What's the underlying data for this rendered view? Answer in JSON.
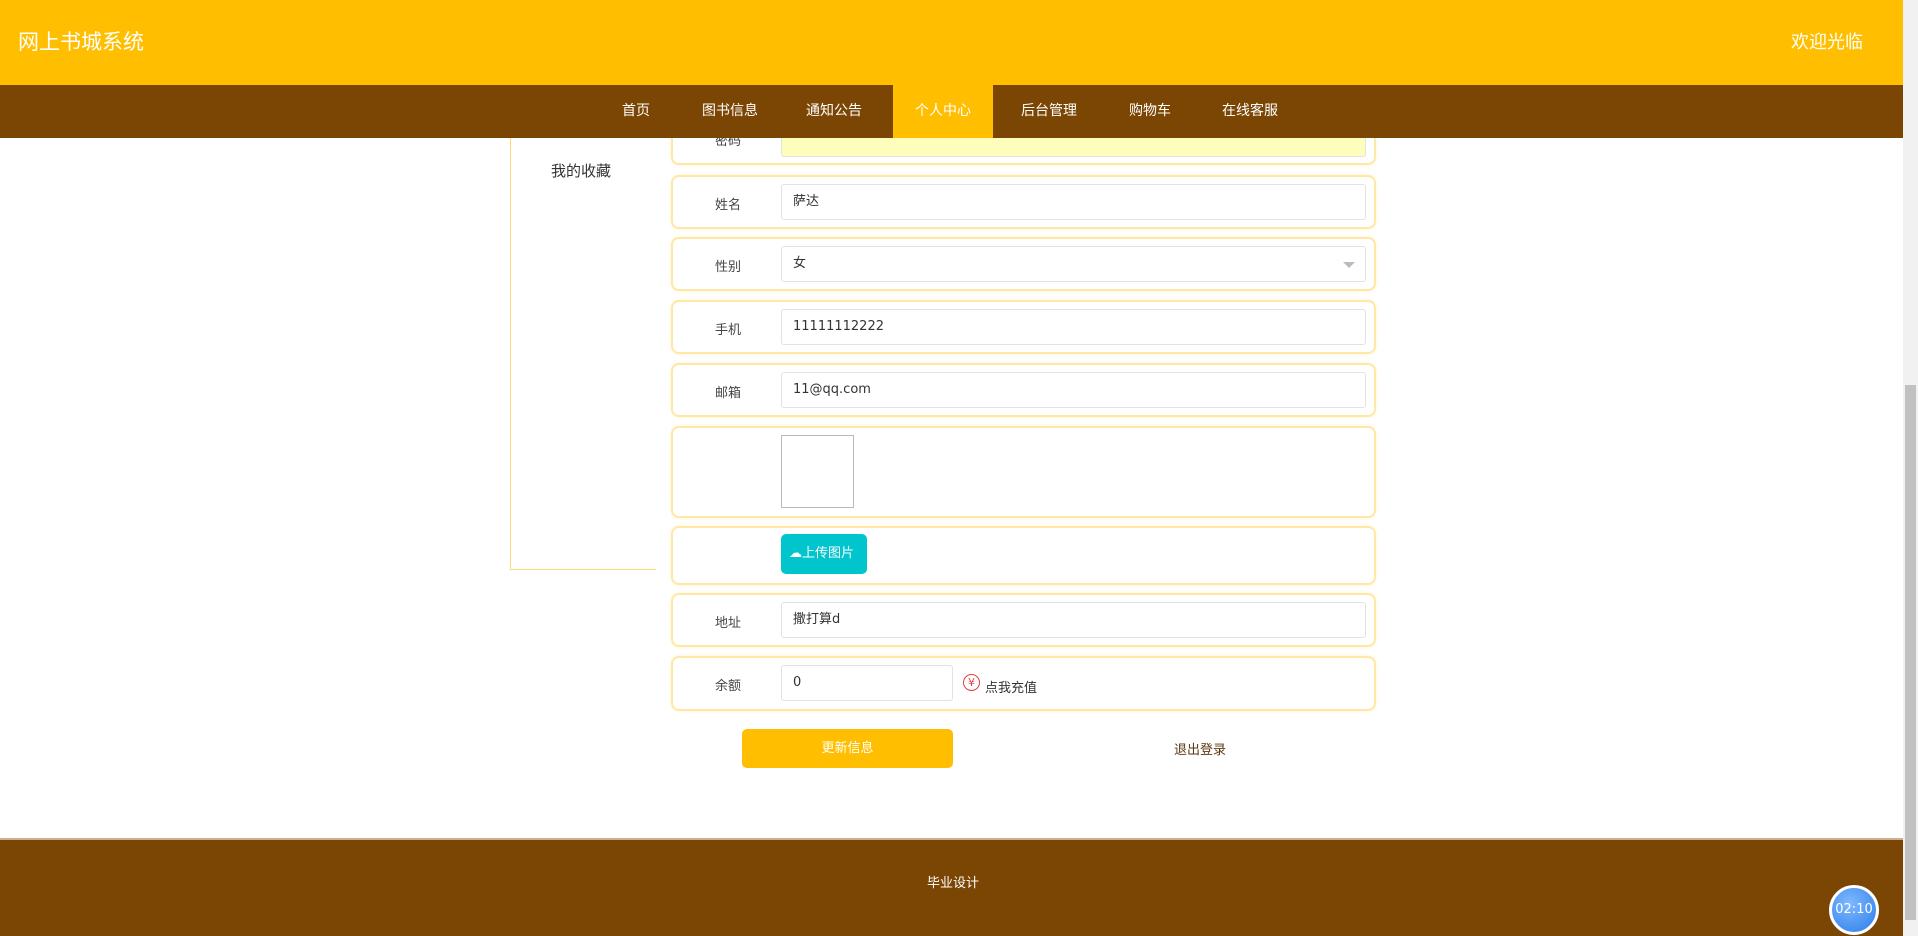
{
  "header": {
    "title": "网上书城系统",
    "welcome": "欢迎光临"
  },
  "nav": {
    "items": [
      {
        "label": "首页"
      },
      {
        "label": "图书信息"
      },
      {
        "label": "通知公告"
      },
      {
        "label": "个人中心",
        "active": true
      },
      {
        "label": "后台管理"
      },
      {
        "label": "购物车"
      },
      {
        "label": "在线客服"
      }
    ]
  },
  "sidebar": {
    "items": [
      {
        "label": "我的收藏"
      }
    ]
  },
  "form": {
    "password": {
      "label": "密码"
    },
    "name": {
      "label": "姓名",
      "value": "萨达"
    },
    "gender": {
      "label": "性别",
      "value": "女"
    },
    "phone": {
      "label": "手机",
      "value": "11111112222"
    },
    "email": {
      "label": "邮箱",
      "value": "11@qq.com"
    },
    "upload_label": "上传图片",
    "address": {
      "label": "地址",
      "value": "撒打算d"
    },
    "balance": {
      "label": "余额",
      "value": "0",
      "recharge": "点我充值",
      "currency_symbol": "¥"
    },
    "update_button": "更新信息",
    "logout_link": "退出登录"
  },
  "footer": {
    "text": "毕业设计"
  },
  "timer": {
    "value": "02:10"
  },
  "colors": {
    "primary": "#ffbf00",
    "nav": "#7b4503",
    "upload": "#00c5cd"
  }
}
